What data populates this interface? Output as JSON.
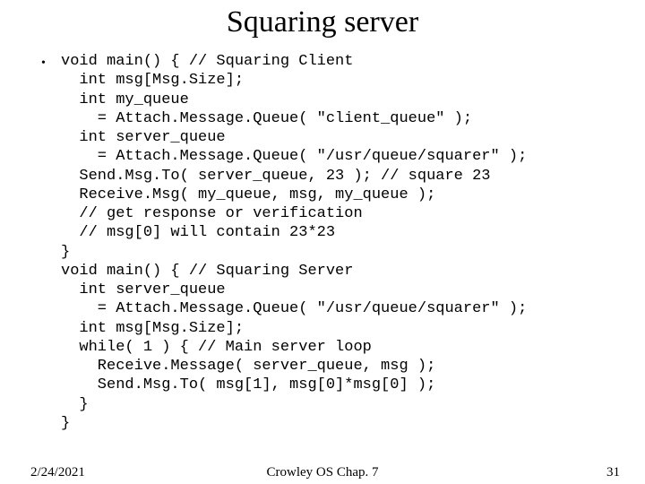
{
  "title": "Squaring server",
  "bullet_glyph": "•",
  "code_lines": [
    "void main() { // Squaring Client",
    "  int msg[Msg.Size];",
    "  int my_queue",
    "    = Attach.Message.Queue( \"client_queue\" );",
    "  int server_queue",
    "    = Attach.Message.Queue( \"/usr/queue/squarer\" );",
    "  Send.Msg.To( server_queue, 23 ); // square 23",
    "  Receive.Msg( my_queue, msg, my_queue );",
    "  // get response or verification",
    "  // msg[0] will contain 23*23",
    "}",
    "void main() { // Squaring Server",
    "  int server_queue",
    "    = Attach.Message.Queue( \"/usr/queue/squarer\" );",
    "  int msg[Msg.Size];",
    "  while( 1 ) { // Main server loop",
    "    Receive.Message( server_queue, msg );",
    "    Send.Msg.To( msg[1], msg[0]*msg[0] );",
    "  }",
    "}"
  ],
  "footer": {
    "date": "2/24/2021",
    "center": "Crowley   OS   Chap. 7",
    "page": "31"
  }
}
